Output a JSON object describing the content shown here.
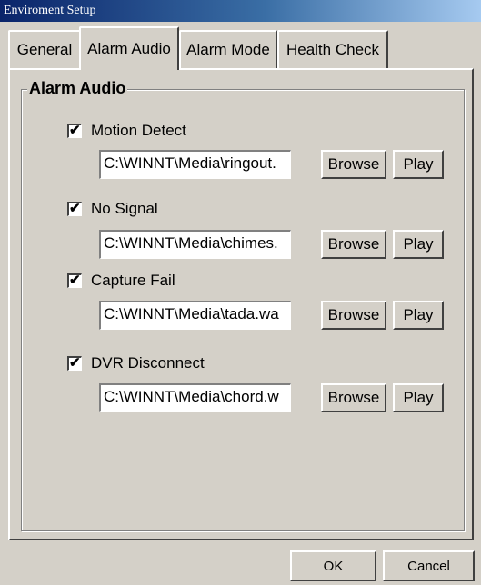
{
  "window": {
    "title": "Enviroment Setup"
  },
  "tabs": [
    {
      "label": "General",
      "active": false
    },
    {
      "label": "Alarm Audio",
      "active": true
    },
    {
      "label": "Alarm Mode",
      "active": false
    },
    {
      "label": "Health Check",
      "active": false
    }
  ],
  "group": {
    "title": "Alarm Audio"
  },
  "alarms": [
    {
      "label": "Motion Detect",
      "checked": true,
      "path": "C:\\WINNT\\Media\\ringout.",
      "browse": "Browse",
      "play": "Play"
    },
    {
      "label": "No Signal",
      "checked": true,
      "path": "C:\\WINNT\\Media\\chimes.",
      "browse": "Browse",
      "play": "Play"
    },
    {
      "label": "Capture Fail",
      "checked": true,
      "path": "C:\\WINNT\\Media\\tada.wa",
      "browse": "Browse",
      "play": "Play"
    },
    {
      "label": "DVR Disconnect",
      "checked": true,
      "path": "C:\\WINNT\\Media\\chord.w",
      "browse": "Browse",
      "play": "Play"
    }
  ],
  "buttons": {
    "ok": "OK",
    "cancel": "Cancel"
  },
  "glyphs": {
    "check": "✔"
  }
}
